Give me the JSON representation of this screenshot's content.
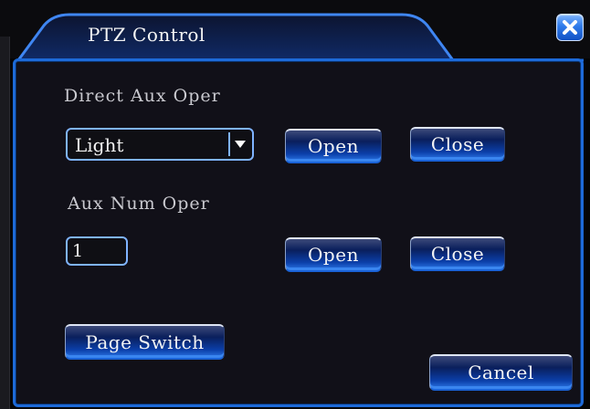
{
  "window": {
    "title": "PTZ Control",
    "close_icon": "close-icon",
    "accent_color": "#1d6ad8"
  },
  "direct_aux": {
    "label": "Direct Aux Oper",
    "select_value": "Light",
    "open_label": "Open",
    "close_label": "Close"
  },
  "aux_num": {
    "label": "Aux Num Oper",
    "input_value": "1",
    "open_label": "Open",
    "close_label": "Close"
  },
  "footer": {
    "page_switch_label": "Page Switch",
    "cancel_label": "Cancel"
  }
}
